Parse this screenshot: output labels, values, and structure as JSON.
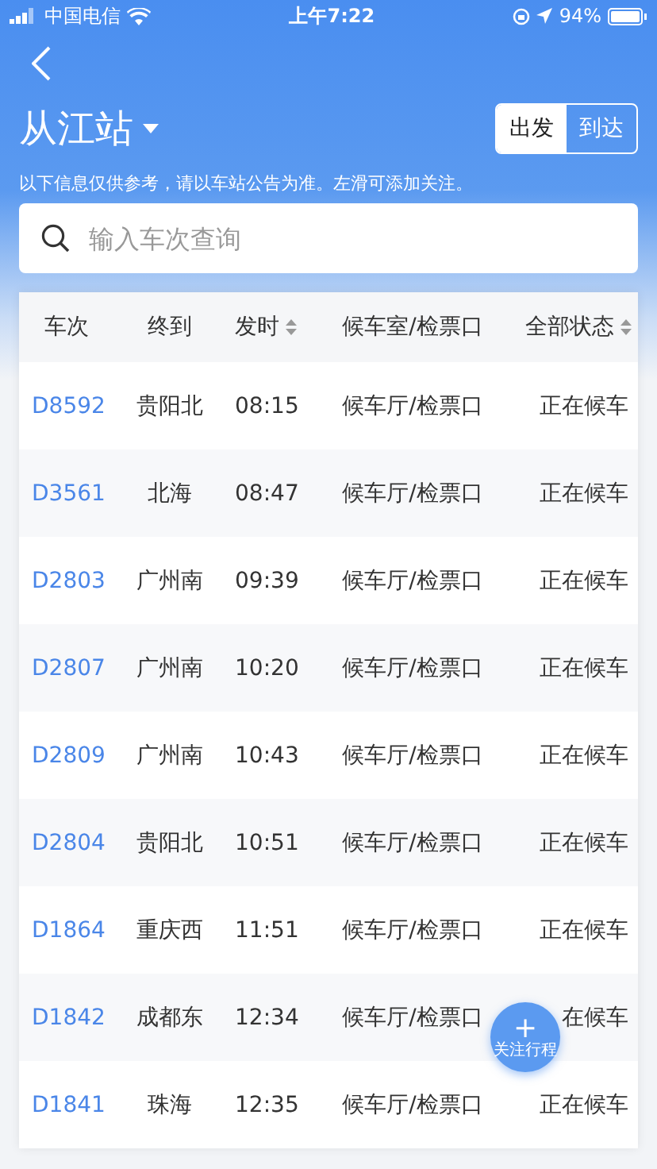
{
  "status_bar": {
    "carrier": "中国电信",
    "time": "上午7:22",
    "battery": "94%"
  },
  "header": {
    "station": "从江站",
    "direction_tabs": [
      {
        "label": "出发",
        "selected": true
      },
      {
        "label": "到达",
        "selected": false
      }
    ],
    "notice": "以下信息仅供参考，请以车站公告为准。左滑可添加关注。"
  },
  "search": {
    "placeholder": "输入车次查询"
  },
  "table": {
    "columns": [
      {
        "label": "车次",
        "sortable": false
      },
      {
        "label": "终到",
        "sortable": false
      },
      {
        "label": "发时",
        "sortable": true
      },
      {
        "label": "候车室/检票口",
        "sortable": false
      },
      {
        "label": "全部状态",
        "sortable": true
      }
    ],
    "rows": [
      [
        "D8592",
        "贵阳北",
        "08:15",
        "候车厅/检票口",
        "正在候车"
      ],
      [
        "D3561",
        "北海",
        "08:47",
        "候车厅/检票口",
        "正在候车"
      ],
      [
        "D2803",
        "广州南",
        "09:39",
        "候车厅/检票口",
        "正在候车"
      ],
      [
        "D2807",
        "广州南",
        "10:20",
        "候车厅/检票口",
        "正在候车"
      ],
      [
        "D2809",
        "广州南",
        "10:43",
        "候车厅/检票口",
        "正在候车"
      ],
      [
        "D2804",
        "贵阳北",
        "10:51",
        "候车厅/检票口",
        "正在候车"
      ],
      [
        "D1864",
        "重庆西",
        "11:51",
        "候车厅/检票口",
        "正在候车"
      ],
      [
        "D1842",
        "成都东",
        "12:34",
        "候车厅/检票口",
        "在候车"
      ],
      [
        "D1841",
        "珠海",
        "12:35",
        "候车厅/检票口",
        "正在候车"
      ]
    ]
  },
  "fab": {
    "symbol": "+",
    "label": "关注行程"
  }
}
